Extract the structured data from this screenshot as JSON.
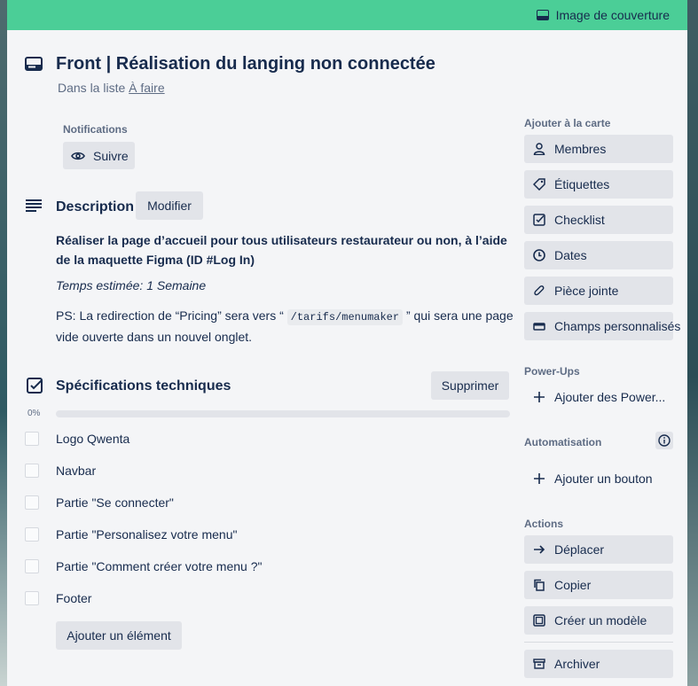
{
  "cover": {
    "label": "Image de couverture"
  },
  "card": {
    "title": "Front | Réalisation du langing non connectée",
    "in_list_prefix": "Dans la liste ",
    "in_list_link": "À faire"
  },
  "notifications": {
    "heading": "Notifications",
    "follow_label": "Suivre"
  },
  "description": {
    "heading": "Description",
    "modify_label": "Modifier",
    "bold_text": "Réaliser la page d’accueil pour tous utilisateurs restaurateur ou non, à l’aide de la maquette Figma (ID #Log In)",
    "italic_text": "Temps estimée: 1 Semaine",
    "ps_before": "PS: La redirection de “Pricing” sera vers “ ",
    "ps_code": "/tarifs/menumaker",
    "ps_after": " ” qui sera une page vide ouverte dans un nouvel onglet."
  },
  "checklist": {
    "heading": "Spécifications techniques",
    "delete_label": "Supprimer",
    "progress_label": "0%",
    "progress": 0,
    "items": [
      {
        "label": "Logo Qwenta",
        "checked": false
      },
      {
        "label": "Navbar",
        "checked": false
      },
      {
        "label": "Partie \"Se connecter\"",
        "checked": false
      },
      {
        "label": "Partie \"Personalisez votre menu\"",
        "checked": false
      },
      {
        "label": "Partie \"Comment créer votre menu ?\"",
        "checked": false
      },
      {
        "label": "Footer",
        "checked": false
      }
    ],
    "add_item_label": "Ajouter un élément"
  },
  "sidebar": {
    "add_heading": "Ajouter à la carte",
    "add_items": [
      {
        "label": "Membres",
        "icon": "person-icon"
      },
      {
        "label": "Étiquettes",
        "icon": "tag-icon"
      },
      {
        "label": "Checklist",
        "icon": "checklist-icon"
      },
      {
        "label": "Dates",
        "icon": "clock-icon"
      },
      {
        "label": "Pièce jointe",
        "icon": "paperclip-icon"
      },
      {
        "label": "Champs personnalisés",
        "icon": "custom-fields-icon"
      }
    ],
    "powerups_heading": "Power-Ups",
    "powerups_add": "Ajouter des Power...",
    "automation_heading": "Automatisation",
    "automation_add": "Ajouter un bouton",
    "actions_heading": "Actions",
    "actions": [
      {
        "label": "Déplacer",
        "icon": "arrow-right-icon"
      },
      {
        "label": "Copier",
        "icon": "copy-icon"
      },
      {
        "label": "Créer un modèle",
        "icon": "template-icon"
      }
    ],
    "archive_label": "Archiver"
  },
  "colors": {
    "cover": "#4bce97",
    "card_bg": "#f4f5f7",
    "button_bg": "#e2e4e9",
    "text": "#172b4d",
    "muted": "#5e6c84"
  }
}
